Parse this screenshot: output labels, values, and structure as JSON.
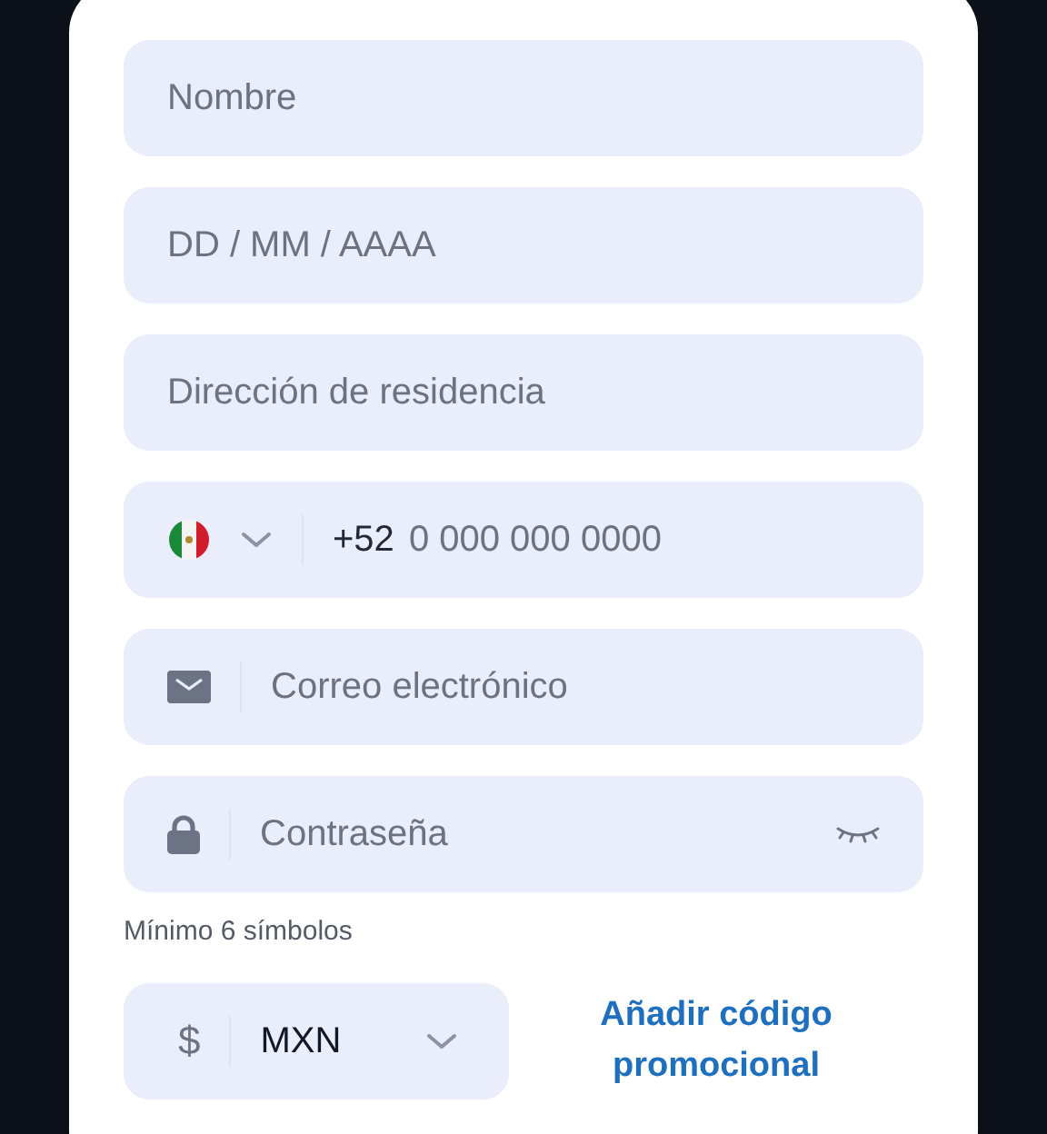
{
  "fields": [
    {
      "kind": "text",
      "placeholder": "Nombre"
    },
    {
      "kind": "text",
      "placeholder": "DD / MM / AAAA"
    },
    {
      "kind": "text",
      "placeholder": "Dirección de residencia"
    },
    {
      "kind": "phone",
      "prefix": "+52",
      "placeholder": "0 000 000 0000"
    },
    {
      "kind": "email",
      "placeholder": "Correo electrónico"
    },
    {
      "kind": "password",
      "placeholder": "Contraseña"
    }
  ],
  "password_hint": "Mínimo 6 símbolos",
  "currency": {
    "symbol": "$",
    "value": "MXN"
  },
  "promo_link": "Añadir código promocional"
}
